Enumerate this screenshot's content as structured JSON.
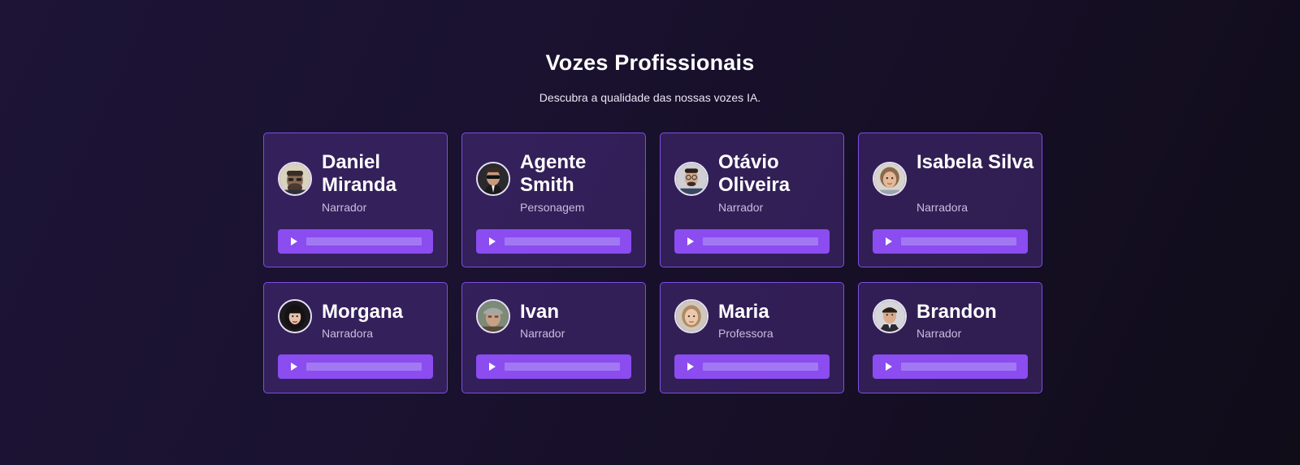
{
  "section": {
    "title": "Vozes Profissionais",
    "subtitle": "Descubra a qualidade das nossas vozes IA."
  },
  "voices": [
    {
      "name": "Daniel Miranda",
      "role": "Narrador",
      "avatar_icon": "avatar-daniel"
    },
    {
      "name": "Agente Smith",
      "role": "Personagem",
      "avatar_icon": "avatar-agente-smith"
    },
    {
      "name": "Otávio Oliveira",
      "role": "Narrador",
      "avatar_icon": "avatar-otavio"
    },
    {
      "name": "Isabela Silva",
      "role": "Narradora",
      "avatar_icon": "avatar-isabela"
    },
    {
      "name": "Morgana",
      "role": "Narradora",
      "avatar_icon": "avatar-morgana"
    },
    {
      "name": "Ivan",
      "role": "Narrador",
      "avatar_icon": "avatar-ivan"
    },
    {
      "name": "Maria",
      "role": "Professora",
      "avatar_icon": "avatar-maria"
    },
    {
      "name": "Brandon",
      "role": "Narrador",
      "avatar_icon": "avatar-brandon"
    }
  ],
  "colors": {
    "accent": "#8b4cf0",
    "card_border": "#7c4ee4",
    "track": "#a278f2",
    "role_text": "#c8bde0"
  }
}
